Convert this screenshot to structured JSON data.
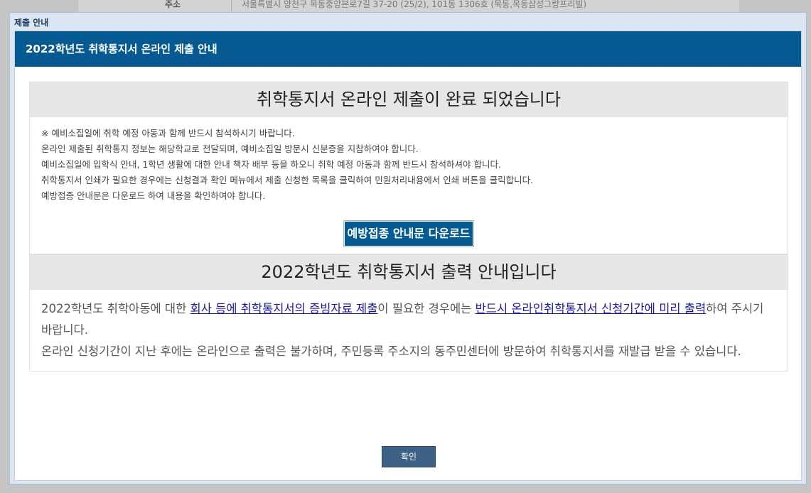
{
  "background": {
    "row_label": "주소",
    "row_value": "서울특별시 양천구 목동중앙본로7길 37-20 (25/2), 101동 1306호 (목동,목동삼성그랑프리빌)"
  },
  "dialog": {
    "title": "제출 안내",
    "header": "2022학년도 취학통지서 온라인 제출 안내"
  },
  "submission": {
    "heading": "취학통지서 온라인 제출이 완료 되었습니다",
    "notes": [
      "※ 예비소집일에 취학 예정 아동과 함께 반드시 참석하시기 바랍니다.",
      "온라인 제출된 취학통지 정보는 해당학교로 전달되며, 예비소집일 방문시 신분증을 지참하여야 합니다.",
      "예비소집일에 입학식 안내, 1학년 생활에 대한 안내 책자 배부 등을 하오니 취학 예정 아동과 함께 반드시 참석하셔야 합니다.",
      "취학통지서 인쇄가 필요한 경우에는 신청결과 확인 메뉴에서 제출 신청한 목록을 클릭하여 민원처리내용에서 인쇄 버튼을 클릭합니다.",
      "예방접종 안내문은 다운로드 하여 내용을 확인하여야 합니다."
    ],
    "download_label": "예방접종 안내문 다운로드"
  },
  "output": {
    "heading": "2022학년도 취학통지서 출력 안내입니다",
    "p1_part1": "2022학년도 취학아동에 대한 ",
    "p1_link1": "회사 등에 취학통지서의 증빙자료 제출",
    "p1_part2": "이 필요한 경우에는 ",
    "p1_link2": "반드시 온라인취학통지서 신청기간에 미리 출력",
    "p1_part3": "하여 주시기 바랍니다.",
    "p2": "온라인 신청기간이 지난 후에는 온라인으로 출력은 불가하며, 주민등록 주소지의 동주민센터에 방문하여 취학통지서를 재발급 받을 수 있습니다."
  },
  "confirm_label": "확인"
}
